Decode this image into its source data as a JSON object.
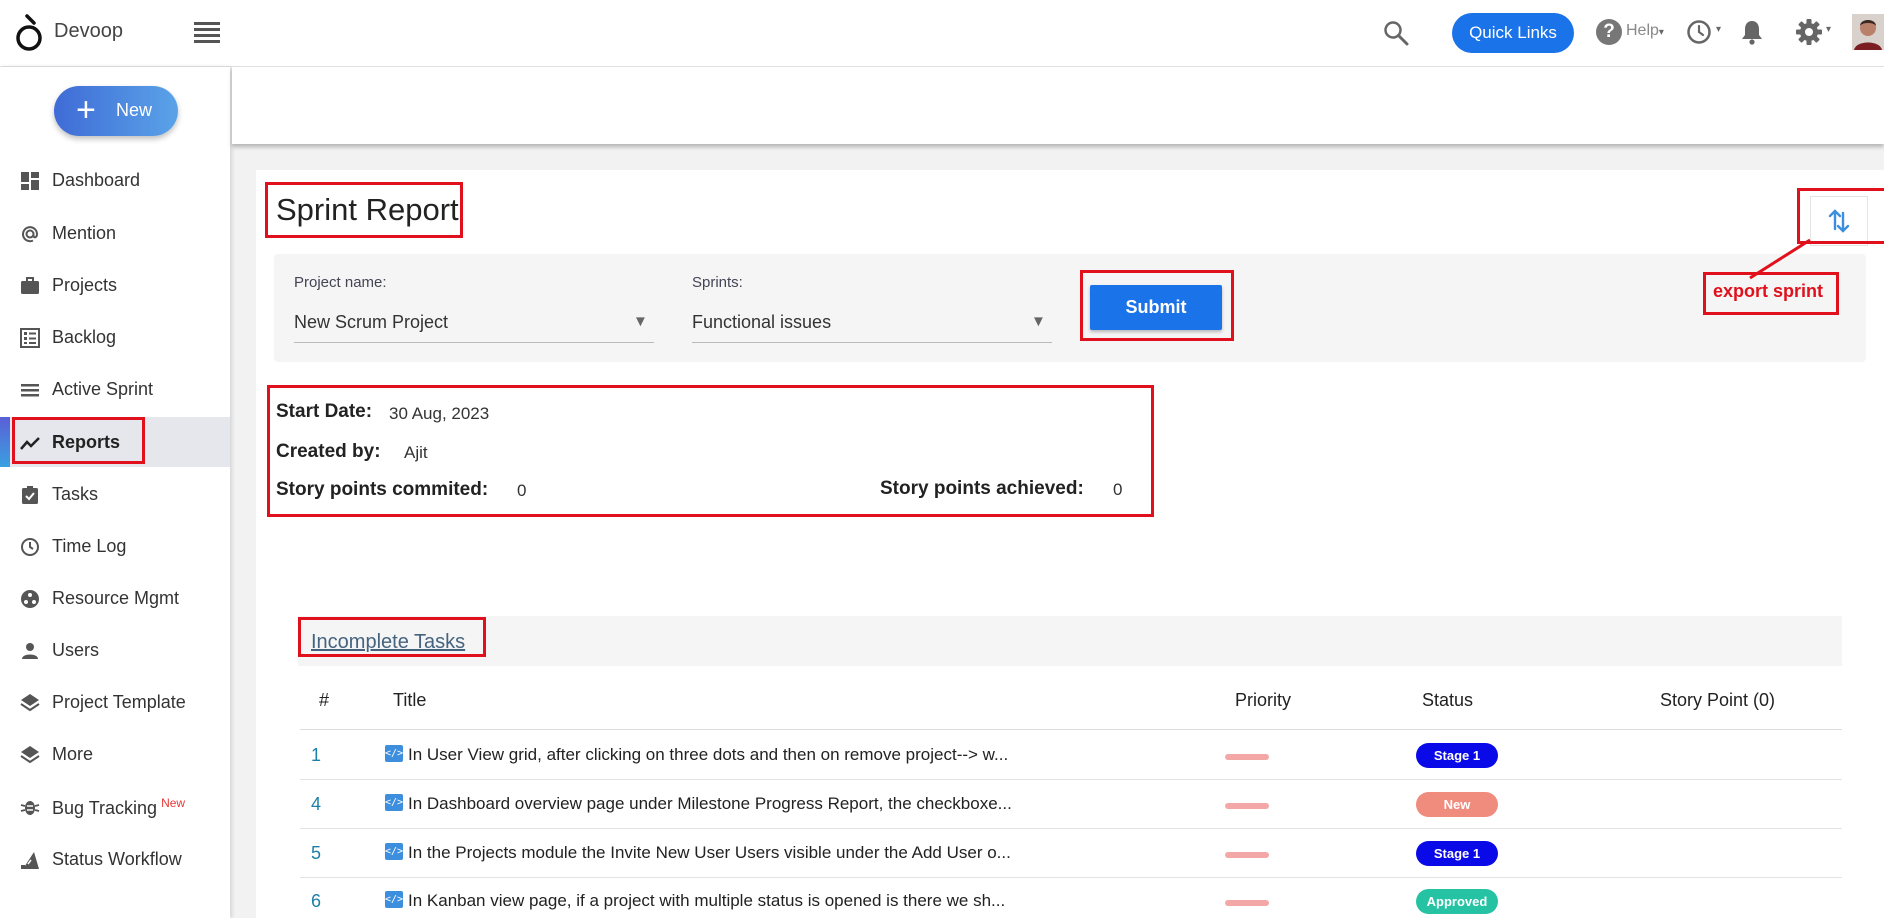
{
  "app": {
    "brand": "Devoop"
  },
  "topbar": {
    "quick_links": "Quick Links",
    "help": "Help",
    "caret": "▾"
  },
  "sidebar": {
    "new_label": "New",
    "items": [
      {
        "label": "Dashboard",
        "icon": "dashboard-icon"
      },
      {
        "label": "Mention",
        "icon": "at-icon"
      },
      {
        "label": "Projects",
        "icon": "briefcase-icon"
      },
      {
        "label": "Backlog",
        "icon": "backlog-icon"
      },
      {
        "label": "Active Sprint",
        "icon": "lines-icon"
      },
      {
        "label": "Reports",
        "icon": "trending-icon",
        "active": true
      },
      {
        "label": "Tasks",
        "icon": "clipboard-check-icon"
      },
      {
        "label": "Time Log",
        "icon": "clock-icon"
      },
      {
        "label": "Resource Mgmt",
        "icon": "resource-icon"
      },
      {
        "label": "Users",
        "icon": "user-icon"
      },
      {
        "label": "Project Template",
        "icon": "layers-icon"
      },
      {
        "label": "More",
        "icon": "layers-icon"
      },
      {
        "label": "Bug Tracking",
        "icon": "bug-icon",
        "badge": "New"
      },
      {
        "label": "Status Workflow",
        "icon": "workflow-icon"
      }
    ]
  },
  "report": {
    "title": "Sprint Report",
    "export_annotation": "export sprint",
    "project_label": "Project name:",
    "project_value": "New Scrum Project",
    "sprints_label": "Sprints:",
    "sprints_value": "Functional issues",
    "submit": "Submit",
    "dropdown_arrow": "▼",
    "start_date_label": "Start Date:",
    "start_date_value": "30 Aug, 2023",
    "created_by_label": "Created by:",
    "created_by_value": "Ajit",
    "committed_label": "Story points commited:",
    "committed_value": "0",
    "achieved_label": "Story points achieved:",
    "achieved_value": "0"
  },
  "incomplete_tasks": {
    "title": "Incomplete Tasks",
    "columns": [
      "#",
      "Title",
      "Priority",
      "Status",
      "Story Point (0)"
    ],
    "rows": [
      {
        "num": "1",
        "title": "In User View grid, after clicking on three dots and then on remove project--> w...",
        "status": "Stage 1",
        "status_color": "#0a0ae8"
      },
      {
        "num": "4",
        "title": "In Dashboard overview page under Milestone Progress Report, the checkboxe...",
        "status": "New",
        "status_color": "#ef8c7e"
      },
      {
        "num": "5",
        "title": "In the Projects module the Invite New User Users visible under the Add User o...",
        "status": "Stage 1",
        "status_color": "#0a0ae8"
      },
      {
        "num": "6",
        "title": "In Kanban view page, if a project with multiple status is opened is there we sh...",
        "status": "Approved",
        "status_color": "#26c2a4"
      }
    ]
  },
  "colors": {
    "accent": "#1a73e8",
    "annotation": "#e0111c",
    "priority": "#f3a7a7"
  }
}
